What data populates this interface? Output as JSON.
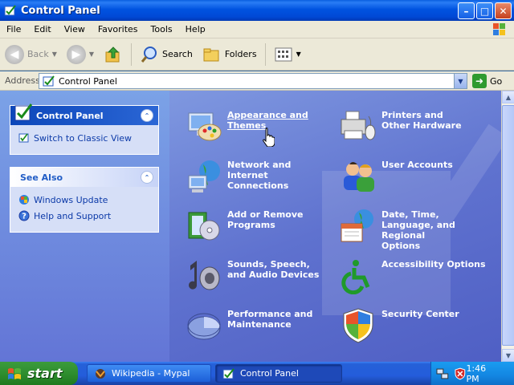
{
  "window": {
    "title": "Control Panel"
  },
  "menu": [
    "File",
    "Edit",
    "View",
    "Favorites",
    "Tools",
    "Help"
  ],
  "toolbar": {
    "back": "Back",
    "search": "Search",
    "folders": "Folders"
  },
  "address": {
    "label": "Address",
    "value": "Control Panel",
    "go": "Go"
  },
  "left_pane": {
    "panel_title": "Control Panel",
    "switch_view": "Switch to Classic View",
    "see_also_title": "See Also",
    "see_also": [
      "Windows Update",
      "Help and Support"
    ]
  },
  "categories": [
    {
      "label": "Appearance and Themes",
      "icon": "appearance-icon"
    },
    {
      "label": "Printers and Other Hardware",
      "icon": "printer-icon"
    },
    {
      "label": "Network and Internet Connections",
      "icon": "network-icon"
    },
    {
      "label": "User Accounts",
      "icon": "users-icon"
    },
    {
      "label": "Add or Remove Programs",
      "icon": "add-remove-icon"
    },
    {
      "label": "Date, Time, Language, and Regional Options",
      "icon": "calendar-globe-icon"
    },
    {
      "label": "Sounds, Speech, and Audio Devices",
      "icon": "sound-icon"
    },
    {
      "label": "Accessibility Options",
      "icon": "accessibility-icon"
    },
    {
      "label": "Performance and Maintenance",
      "icon": "performance-icon"
    },
    {
      "label": "Security Center",
      "icon": "shield-icon"
    }
  ],
  "taskbar": {
    "start": "start",
    "tasks": [
      {
        "label": "Wikipedia - Mypal"
      },
      {
        "label": "Control Panel"
      }
    ],
    "clock": "1:46 PM"
  }
}
